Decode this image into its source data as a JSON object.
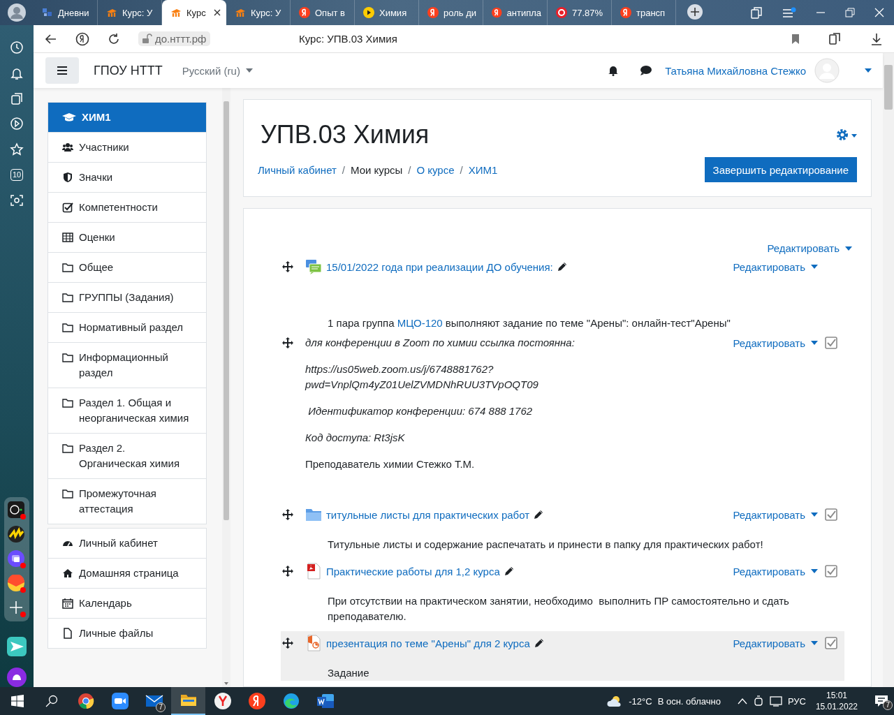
{
  "browser": {
    "tabs": [
      {
        "label": "Дневни",
        "kind": "diary",
        "selected": false
      },
      {
        "label": "Курс: У",
        "kind": "moodle",
        "selected": false
      },
      {
        "label": "Курс",
        "kind": "moodle",
        "selected": true
      },
      {
        "label": "Курс: У",
        "kind": "moodle",
        "selected": false
      },
      {
        "label": "Опыт в",
        "kind": "yandex",
        "selected": false
      },
      {
        "label": "Химия",
        "kind": "play",
        "selected": false
      },
      {
        "label": "роль ди",
        "kind": "yandex",
        "selected": false
      },
      {
        "label": "антипла",
        "kind": "yandex",
        "selected": false
      },
      {
        "label": "77.87%",
        "kind": "ring",
        "selected": false
      },
      {
        "label": "трансп",
        "kind": "yandex",
        "selected": false
      }
    ],
    "address": "до.нттт.рф",
    "page_title": "Курс: УПВ.03 Химия",
    "sidebar_badge": "10"
  },
  "navbar": {
    "site_name": "ГПОУ НТТТ",
    "language": "Русский (ru)",
    "user_name": "Татьяна Михайловна Стежко"
  },
  "drawer": {
    "course_items": [
      {
        "label": "ХИМ1",
        "kind": "cap",
        "selected": true
      },
      {
        "label": "Участники",
        "kind": "users",
        "selected": false
      },
      {
        "label": "Значки",
        "kind": "shield",
        "selected": false
      },
      {
        "label": "Компетентности",
        "kind": "check",
        "selected": false
      },
      {
        "label": "Оценки",
        "kind": "table",
        "selected": false
      },
      {
        "label": "Общее",
        "kind": "folder",
        "selected": false
      },
      {
        "label": "ГРУППЫ (Задания)",
        "kind": "folder",
        "selected": false
      },
      {
        "label": "Нормативный раздел",
        "kind": "folder",
        "selected": false
      },
      {
        "label": "Информационный раздел",
        "kind": "folder",
        "selected": false
      },
      {
        "label": "Раздел 1. Общая и неорганическая химия",
        "kind": "folder",
        "selected": false
      },
      {
        "label": "Раздел 2. Органическая химия",
        "kind": "folder",
        "selected": false
      },
      {
        "label": "Промежуточная аттестация",
        "kind": "folder",
        "selected": false
      }
    ],
    "site_items": [
      {
        "label": "Личный кабинет",
        "kind": "dashboard",
        "selected": false
      },
      {
        "label": "Домашняя страница",
        "kind": "home",
        "selected": false
      },
      {
        "label": "Календарь",
        "kind": "calendar",
        "selected": false
      },
      {
        "label": "Личные файлы",
        "kind": "file",
        "selected": false
      }
    ]
  },
  "header": {
    "title": "УПВ.03 Химия",
    "breadcrumbs": [
      {
        "label": "Личный кабинет",
        "link": true
      },
      {
        "label": "Мои курсы",
        "link": false
      },
      {
        "label": "О курсе",
        "link": true
      },
      {
        "label": "ХИМ1",
        "link": true
      }
    ],
    "separators": [
      "/",
      "/",
      "/"
    ],
    "button": "Завершить редактирование"
  },
  "section": {
    "edit_menu": "Редактировать",
    "activities": [
      {
        "kind": "forum",
        "title": "15/01/2022 года при реализации ДО обучения:",
        "edit_menu": "Редактировать",
        "highlighted": false,
        "description": [
          {
            "text": "1 пара группа ",
            "link": false
          },
          {
            "text": "МЦО-120",
            "link": true
          },
          {
            "text": " выполняют задание по теме \"Арены\": онлайн-тест\"Арены\"",
            "link": false
          }
        ]
      },
      {
        "kind": "label",
        "edit_menu": "Редактировать",
        "checked": true,
        "highlighted": false,
        "paragraphs": [
          {
            "lines": [
              "для конференции в Zoom по химии ссылка постоянна:"
            ],
            "italic": true
          },
          {
            "lines": [
              "https://us05web.zoom.us/j/6748881762?",
              "pwd=VnplQm4yZ01UelZVMDNhRUU3TVpOQT09"
            ],
            "italic": true
          },
          {
            "lines": [
              " Идентификатор конференции: 674 888 1762"
            ],
            "italic": true
          },
          {
            "lines": [
              "Код доступа: Rt3jsK"
            ],
            "italic": true
          },
          {
            "lines": [
              "Преподаватель химии Стежко Т.М."
            ],
            "italic": false
          }
        ]
      },
      {
        "kind": "folder",
        "title": "титульные листы для практических работ",
        "edit_menu": "Редактировать",
        "checked": true,
        "highlighted": false,
        "description": [
          {
            "text": "Титульные листы и содержание распечатать и принести в папку для практических работ!",
            "link": false
          }
        ]
      },
      {
        "kind": "pdf",
        "title": "Практические работы для 1,2 курса",
        "edit_menu": "Редактировать",
        "checked": true,
        "highlighted": false,
        "description": [
          {
            "text": "При отсутствии на практическом занятии, необходимо  выполнить ПР самостоятельно и сдать преподавателю.",
            "link": false
          }
        ]
      },
      {
        "kind": "presentation",
        "title": "презентация по теме \"Арены\" для 2 курса",
        "edit_menu": "Редактировать",
        "checked": true,
        "highlighted": true,
        "description": [
          {
            "text": "Задание",
            "link": false
          }
        ]
      }
    ]
  },
  "taskbar": {
    "apps": [
      {
        "kind": "chrome",
        "active": false
      },
      {
        "kind": "zoom",
        "active": false
      },
      {
        "kind": "mail",
        "active": false,
        "badge": "7"
      },
      {
        "kind": "explorer",
        "active": true
      },
      {
        "kind": "ybrowser",
        "active": false
      },
      {
        "kind": "yandex",
        "active": false
      },
      {
        "kind": "edge",
        "active": false
      },
      {
        "kind": "word",
        "active": false
      }
    ],
    "temperature": "-12°C",
    "weather": "В осн. облачно",
    "language": "РУС",
    "time": "15:01",
    "date": "15.01.2022",
    "notifications": "7"
  }
}
